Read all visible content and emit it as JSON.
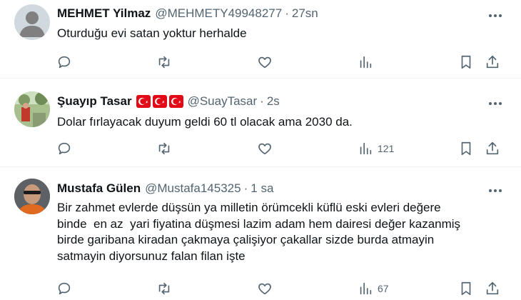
{
  "tweets": [
    {
      "name": "MEHMET Yilmaz",
      "handle": "@MEHMETY49948277",
      "time": "27sn",
      "flags": [],
      "text": [
        "Oturduğu evi satan yoktur herhalde"
      ],
      "views": ""
    },
    {
      "name": "Şuayıp Tasar",
      "handle": "@SuayTasar",
      "time": "2s",
      "flags": [
        "turkey-flag",
        "turkey-flag",
        "turkey-flag"
      ],
      "text": [
        "Dolar fırlayacak duyum geldi 60 tl olacak ama 2030 da."
      ],
      "views": "121"
    },
    {
      "name": "Mustafa Gülen",
      "handle": "@Mustafa145325",
      "time": "1 sa",
      "flags": [],
      "text": [
        "Bir zahmet evlerde düşsün ya milletin örümcekli küflü eski evleri değere",
        "binde  en az  yari fiyatina düşmesi lazim adam hem dairesi değer kazanmiş",
        "birde garibana kiradan çakmaya çalişiyor çakallar sizde burda atmayin",
        "satmayin diyorsunuz falan filan işte"
      ],
      "views": "67"
    }
  ],
  "icons": {
    "reply": "reply-icon",
    "retweet": "retweet-icon",
    "like": "like-icon",
    "views": "views-icon",
    "bookmark": "bookmark-icon",
    "share": "share-icon",
    "more": "more-icon"
  },
  "colors": {
    "text": "#0f1419",
    "secondary": "#536471",
    "divider": "#eff3f4",
    "flag": "#e30a17"
  }
}
